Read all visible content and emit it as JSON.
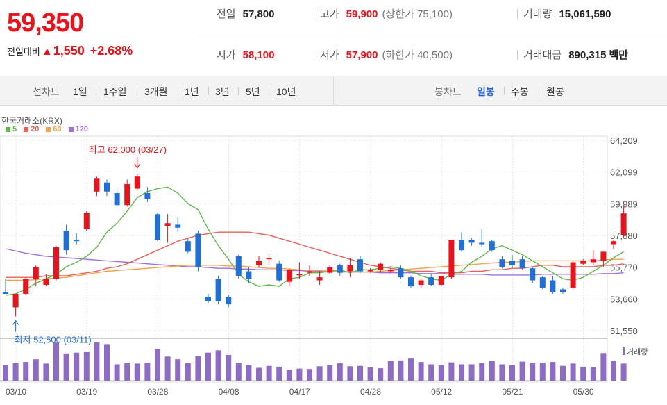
{
  "quote": {
    "price": "59,350",
    "change_label": "전일대비",
    "change_arrow": "▲",
    "change_value": "1,550",
    "change_pct": "+2.68%"
  },
  "stats": {
    "prev_close": {
      "label": "전일",
      "value": "57,800"
    },
    "high": {
      "label": "고가",
      "value": "59,900",
      "limit_label": "(상한가 75,100)"
    },
    "volume": {
      "label": "거래량",
      "value": "15,061,590"
    },
    "open": {
      "label": "시가",
      "value": "58,100"
    },
    "low": {
      "label": "저가",
      "value": "57,900",
      "limit_label": "(하한가 40,500)"
    },
    "amount": {
      "label": "거래대금",
      "value": "890,315",
      "unit": "백만"
    }
  },
  "toolbar": {
    "line_label": "선차트",
    "line_periods": [
      "1일",
      "1주일",
      "3개월",
      "1년",
      "3년",
      "5년",
      "10년"
    ],
    "candle_label": "봉차트",
    "candle_periods": [
      "일봉",
      "주봉",
      "월봉"
    ],
    "candle_active": "일봉"
  },
  "colors": {
    "up": "#e8131b",
    "down": "#1f6fd6",
    "ma5": "#5fb84a",
    "ma20": "#e8605a",
    "ma60": "#f2a24a",
    "ma120": "#a070d8",
    "volume": "#8e6bc4"
  },
  "chart_data": {
    "type": "candlestick",
    "source": "한국거래소(KRX)",
    "legend": [
      {
        "name": "5",
        "color": "#5fb84a"
      },
      {
        "name": "20",
        "color": "#e8605a"
      },
      {
        "name": "60",
        "color": "#f2a24a"
      },
      {
        "name": "120",
        "color": "#a070d8"
      }
    ],
    "y_ticks": [
      "64,209",
      "62,099",
      "59,989",
      "57,880",
      "55,770",
      "53,660",
      "51,550"
    ],
    "ylim": [
      51550,
      64209
    ],
    "x_ticks": [
      {
        "label": "03/10",
        "index": 0
      },
      {
        "label": "03/19",
        "index": 7
      },
      {
        "label": "03/28",
        "index": 14
      },
      {
        "label": "04/08",
        "index": 21
      },
      {
        "label": "04/17",
        "index": 28
      },
      {
        "label": "04/28",
        "index": 35
      },
      {
        "label": "05/12",
        "index": 42
      },
      {
        "label": "05/21",
        "index": 49
      },
      {
        "label": "05/30",
        "index": 56
      }
    ],
    "annotations": {
      "high": {
        "label": "최고 62,000 (03/27)",
        "index": 13,
        "value": 62000
      },
      "low": {
        "label": "최저 52,500 (03/11)",
        "index": 1,
        "value": 52500
      }
    },
    "volume_label": "거래량",
    "candles": [
      {
        "o": 54100,
        "h": 55000,
        "l": 54000,
        "c": 54000
      },
      {
        "o": 53100,
        "h": 54000,
        "l": 52500,
        "c": 54000
      },
      {
        "o": 54000,
        "h": 55100,
        "l": 53900,
        "c": 55000
      },
      {
        "o": 55000,
        "h": 55900,
        "l": 54500,
        "c": 55800
      },
      {
        "o": 54600,
        "h": 55300,
        "l": 54500,
        "c": 55000
      },
      {
        "o": 55000,
        "h": 57200,
        "l": 54900,
        "c": 57100
      },
      {
        "o": 58200,
        "h": 58600,
        "l": 56600,
        "c": 56900
      },
      {
        "o": 57600,
        "h": 58000,
        "l": 57300,
        "c": 57500
      },
      {
        "o": 58300,
        "h": 59500,
        "l": 58200,
        "c": 59400
      },
      {
        "o": 60800,
        "h": 61800,
        "l": 60500,
        "c": 61700
      },
      {
        "o": 61400,
        "h": 61600,
        "l": 60500,
        "c": 60800
      },
      {
        "o": 60700,
        "h": 61000,
        "l": 59800,
        "c": 59900
      },
      {
        "o": 59900,
        "h": 61600,
        "l": 59800,
        "c": 61300
      },
      {
        "o": 61000,
        "h": 62000,
        "l": 60900,
        "c": 61800
      },
      {
        "o": 60700,
        "h": 61100,
        "l": 60100,
        "c": 60300
      },
      {
        "o": 59300,
        "h": 59400,
        "l": 57500,
        "c": 57600
      },
      {
        "o": 58500,
        "h": 59300,
        "l": 57400,
        "c": 58700
      },
      {
        "o": 58600,
        "h": 59100,
        "l": 58100,
        "c": 58400
      },
      {
        "o": 57500,
        "h": 57700,
        "l": 56700,
        "c": 56800
      },
      {
        "o": 58000,
        "h": 58200,
        "l": 55500,
        "c": 55800
      },
      {
        "o": 53800,
        "h": 54000,
        "l": 53400,
        "c": 53500
      },
      {
        "o": 55000,
        "h": 55200,
        "l": 53300,
        "c": 53500
      },
      {
        "o": 53800,
        "h": 53900,
        "l": 53100,
        "c": 53300
      },
      {
        "o": 56500,
        "h": 56600,
        "l": 55000,
        "c": 55200
      },
      {
        "o": 55500,
        "h": 55800,
        "l": 54700,
        "c": 55000
      },
      {
        "o": 55900,
        "h": 56500,
        "l": 55800,
        "c": 56200
      },
      {
        "o": 56300,
        "h": 56700,
        "l": 55900,
        "c": 56400
      },
      {
        "o": 56000,
        "h": 56200,
        "l": 54800,
        "c": 54900
      },
      {
        "o": 54800,
        "h": 55700,
        "l": 54500,
        "c": 55600
      },
      {
        "o": 55300,
        "h": 56100,
        "l": 55000,
        "c": 55300
      },
      {
        "o": 55400,
        "h": 55900,
        "l": 55200,
        "c": 55500
      },
      {
        "o": 54900,
        "h": 55500,
        "l": 54600,
        "c": 55100
      },
      {
        "o": 55400,
        "h": 55900,
        "l": 55300,
        "c": 55800
      },
      {
        "o": 55900,
        "h": 56000,
        "l": 55200,
        "c": 55400
      },
      {
        "o": 55500,
        "h": 56400,
        "l": 55100,
        "c": 55900
      },
      {
        "o": 56300,
        "h": 56500,
        "l": 55400,
        "c": 55500
      },
      {
        "o": 55500,
        "h": 55700,
        "l": 55400,
        "c": 55600
      },
      {
        "o": 55600,
        "h": 56100,
        "l": 55400,
        "c": 56000
      },
      {
        "o": 55500,
        "h": 55700,
        "l": 55400,
        "c": 55600
      },
      {
        "o": 55700,
        "h": 55900,
        "l": 55000,
        "c": 55100
      },
      {
        "o": 55100,
        "h": 55200,
        "l": 54400,
        "c": 54500
      },
      {
        "o": 54600,
        "h": 55000,
        "l": 54400,
        "c": 54900
      },
      {
        "o": 55100,
        "h": 55300,
        "l": 54500,
        "c": 54600
      },
      {
        "o": 54600,
        "h": 55200,
        "l": 54500,
        "c": 55200
      },
      {
        "o": 55100,
        "h": 57600,
        "l": 55000,
        "c": 57600
      },
      {
        "o": 57600,
        "h": 58100,
        "l": 56800,
        "c": 56900
      },
      {
        "o": 57600,
        "h": 57700,
        "l": 57200,
        "c": 57400
      },
      {
        "o": 57400,
        "h": 58300,
        "l": 57100,
        "c": 57300
      },
      {
        "o": 57500,
        "h": 57600,
        "l": 56800,
        "c": 56900
      },
      {
        "o": 56300,
        "h": 56500,
        "l": 55700,
        "c": 55800
      },
      {
        "o": 56200,
        "h": 56600,
        "l": 55700,
        "c": 55900
      },
      {
        "o": 56300,
        "h": 56500,
        "l": 55600,
        "c": 55700
      },
      {
        "o": 55700,
        "h": 55800,
        "l": 54700,
        "c": 54900
      },
      {
        "o": 55100,
        "h": 55200,
        "l": 54300,
        "c": 54400
      },
      {
        "o": 54900,
        "h": 55200,
        "l": 54000,
        "c": 54100
      },
      {
        "o": 54300,
        "h": 54400,
        "l": 54000,
        "c": 54100
      },
      {
        "o": 54400,
        "h": 56200,
        "l": 54300,
        "c": 56100
      },
      {
        "o": 56000,
        "h": 56300,
        "l": 55900,
        "c": 56200
      },
      {
        "o": 56100,
        "h": 56900,
        "l": 55900,
        "c": 56300
      },
      {
        "o": 56200,
        "h": 56700,
        "l": 55800,
        "c": 56800
      },
      {
        "o": 57300,
        "h": 57600,
        "l": 57000,
        "c": 57500
      },
      {
        "o": 57900,
        "h": 59900,
        "l": 57800,
        "c": 59350
      }
    ],
    "volumes": [
      0.4,
      0.45,
      0.48,
      0.55,
      0.44,
      0.98,
      0.7,
      0.72,
      0.75,
      0.98,
      0.94,
      0.42,
      0.45,
      0.44,
      0.46,
      0.82,
      0.62,
      0.55,
      0.45,
      0.64,
      0.72,
      0.78,
      0.66,
      0.46,
      0.4,
      0.33,
      0.38,
      0.36,
      0.28,
      0.31,
      0.3,
      0.37,
      0.4,
      0.45,
      0.37,
      0.38,
      0.34,
      0.32,
      0.5,
      0.52,
      0.57,
      0.48,
      0.42,
      0.4,
      0.47,
      0.42,
      0.42,
      0.45,
      0.5,
      0.42,
      0.4,
      0.49,
      0.45,
      0.46,
      0.48,
      0.38,
      0.44,
      0.36,
      0.35,
      0.71,
      0.5,
      0.44
    ],
    "ma5": [
      53900,
      54000,
      54300,
      54700,
      55000,
      55300,
      55800,
      56100,
      56500,
      57100,
      58100,
      58700,
      59500,
      60400,
      60800,
      61000,
      61100,
      60700,
      60000,
      59600,
      58300,
      57200,
      56300,
      55300,
      54800,
      54500,
      54600,
      54500,
      55000,
      55100,
      55400,
      55400,
      55500,
      55600,
      55400,
      55600,
      55600,
      55700,
      55800,
      55700,
      55500,
      55200,
      55000,
      54900,
      55300,
      55500,
      56100,
      56500,
      57000,
      57200,
      56900,
      56600,
      56200,
      55800,
      55400,
      55000,
      54900,
      55100,
      55500,
      55900,
      56400,
      56800
    ],
    "ma20": [
      55100,
      55100,
      55100,
      55100,
      55200,
      55200,
      55200,
      55300,
      55400,
      55500,
      55700,
      55800,
      56000,
      56300,
      56600,
      56900,
      57200,
      57500,
      57700,
      57900,
      58000,
      58100,
      58100,
      58100,
      58100,
      58000,
      57900,
      57700,
      57500,
      57300,
      57100,
      56900,
      56700,
      56500,
      56300,
      56100,
      55900,
      55800,
      55700,
      55600,
      55500,
      55500,
      55500,
      55400,
      55400,
      55400,
      55500,
      55500,
      55600,
      55600,
      55700,
      55700,
      55800,
      55900,
      55900,
      55800,
      55800,
      55800,
      55800,
      55900,
      55900,
      56000
    ],
    "ma60": [
      54900,
      54900,
      54900,
      54950,
      55000,
      55050,
      55100,
      55200,
      55300,
      55400,
      55500,
      55550,
      55600,
      55650,
      55700,
      55750,
      55800,
      55850,
      55900,
      55900,
      55900,
      55900,
      55850,
      55850,
      55800,
      55750,
      55700,
      55700,
      55650,
      55600,
      55550,
      55550,
      55500,
      55500,
      55450,
      55450,
      55450,
      55500,
      55550,
      55600,
      55650,
      55700,
      55750,
      55800,
      55850,
      55900,
      55950,
      56000,
      56050,
      56100,
      56100,
      56150,
      56200,
      56200,
      56200,
      56200,
      56200,
      56200,
      56200,
      56250,
      56300,
      56300
    ],
    "ma120": [
      57000,
      56850,
      56700,
      56600,
      56500,
      56450,
      56400,
      56350,
      56300,
      56250,
      56200,
      56150,
      56100,
      56050,
      56000,
      55950,
      55900,
      55850,
      55800,
      55800,
      55750,
      55700,
      55700,
      55650,
      55650,
      55600,
      55600,
      55600,
      55550,
      55550,
      55500,
      55500,
      55500,
      55450,
      55450,
      55450,
      55450,
      55400,
      55400,
      55400,
      55400,
      55350,
      55350,
      55350,
      55300,
      55300,
      55300,
      55300,
      55250,
      55250,
      55250,
      55250,
      55250,
      55300,
      55300,
      55300,
      55300,
      55300,
      55300,
      55350,
      55350,
      55400
    ]
  }
}
